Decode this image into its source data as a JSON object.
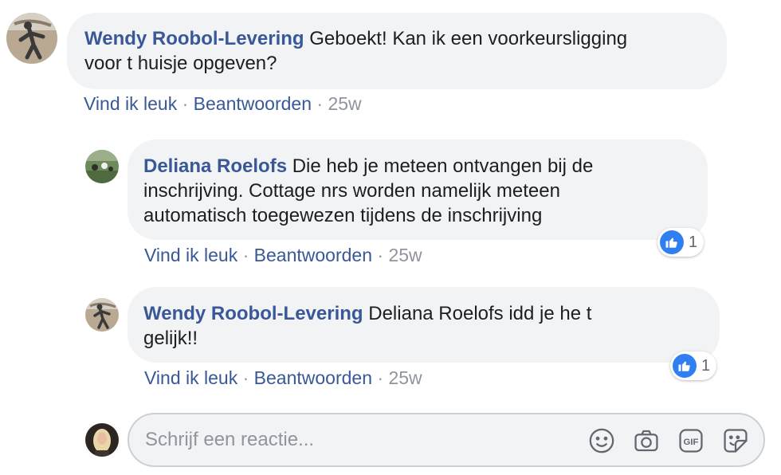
{
  "comments": [
    {
      "author": "Wendy Roobol-Levering",
      "text_lines": [
        "Geboekt! Kan ik een voorkeursligging",
        "voor t huisje opgeven?"
      ],
      "actions": {
        "like": "Vind ik leuk",
        "reply": "Beantwoorden",
        "time": "25w"
      }
    },
    {
      "author": "Deliana Roelofs",
      "text_lines": [
        "Die heb je meteen ontvangen bij de",
        "inschrijving. Cottage nrs worden namelijk meteen",
        "automatisch toegewezen tijdens de inschrijving"
      ],
      "actions": {
        "like": "Vind ik leuk",
        "reply": "Beantwoorden",
        "time": "25w"
      },
      "reaction_count": "1"
    },
    {
      "author": "Wendy Roobol-Levering",
      "text_lines": [
        "Deliana Roelofs idd je he t",
        "gelijk!!"
      ],
      "actions": {
        "like": "Vind ik leuk",
        "reply": "Beantwoorden",
        "time": "25w"
      },
      "reaction_count": "1"
    }
  ],
  "separator": "·",
  "composer": {
    "placeholder": "Schrijf een reactie...",
    "tools": [
      "emoji-icon",
      "camera-icon",
      "gif-icon",
      "sticker-icon"
    ],
    "gif_label": "GIF"
  },
  "colors": {
    "name_blue": "#385898",
    "bubble_bg": "#f2f3f5",
    "meta_gray": "#90949c",
    "like_blue": "#2f7ff2"
  }
}
